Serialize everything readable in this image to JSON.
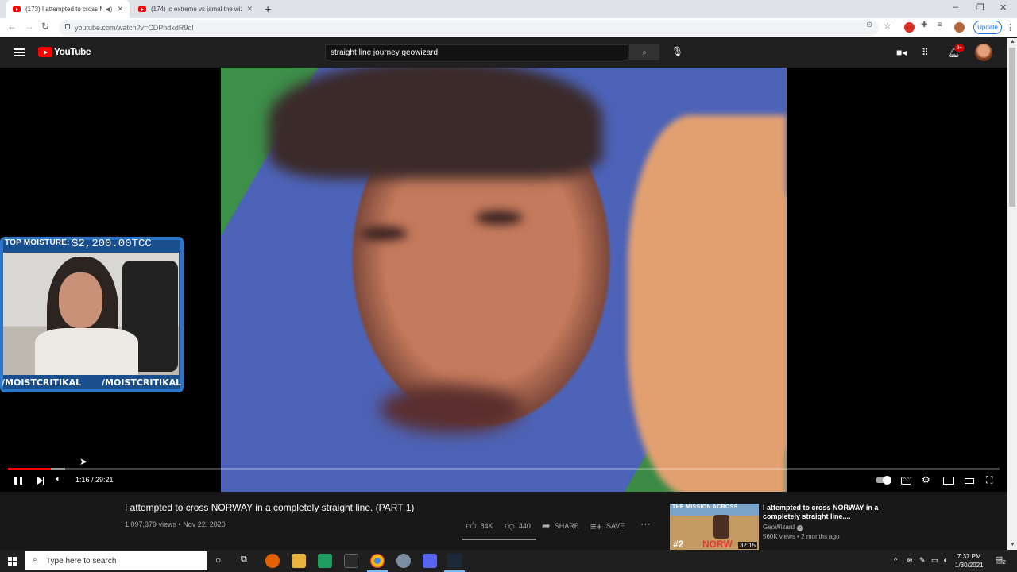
{
  "browser": {
    "tabs": [
      {
        "title": "(173) I attempted to cross N",
        "active": true
      },
      {
        "title": "(174) jc extreme vs jamal the wiz",
        "active": false
      }
    ],
    "url": "youtube.com/watch?v=CDPhdkdR9qI",
    "update_label": "Update"
  },
  "youtube": {
    "logo_text": "YouTube",
    "search_query": "straight line journey geowizard",
    "notification_count": "9+"
  },
  "player": {
    "time": "1:16 / 29:21",
    "progress_fraction": 0.043,
    "loaded_fraction": 0.058
  },
  "overlay": {
    "top_label": "TOP MOISTURE:",
    "amount": "$2,200.00TCC",
    "handle_left": "/MOISTCRITIKAL",
    "handle_right": "/MOISTCRITIKAL"
  },
  "video": {
    "title": "I attempted to cross NORWAY in a completely straight line. (PART 1)",
    "meta": "1,097,379 views • Nov 22, 2020",
    "likes": "84K",
    "dislikes": "440",
    "share_label": "SHARE",
    "save_label": "SAVE"
  },
  "recommendation": {
    "thumb_title": "THE MISSION ACROSS",
    "thumb_number": "#2",
    "thumb_word": "NORW",
    "duration": "32:15",
    "title": "I attempted to cross NORWAY in a completely straight line....",
    "channel": "GeoWizard",
    "stats": "560K views • 2 months ago"
  },
  "taskbar": {
    "search_placeholder": "Type here to search",
    "time": "7:37 PM",
    "date": "1/30/2021",
    "notif": "2"
  }
}
